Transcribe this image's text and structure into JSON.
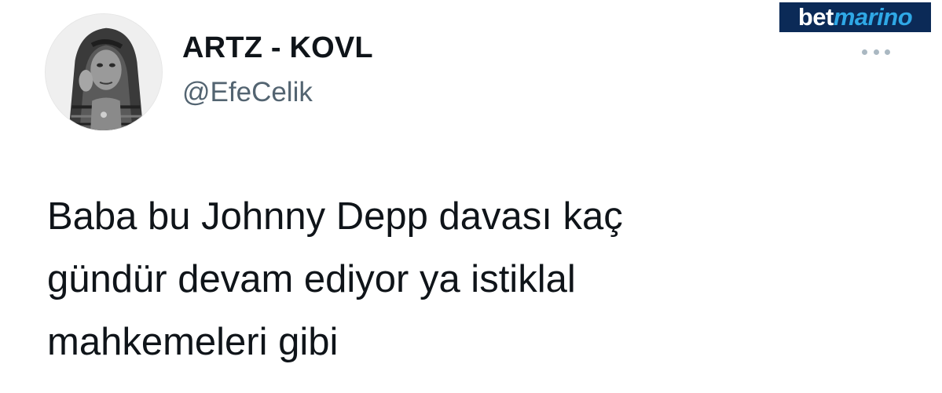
{
  "tweet": {
    "display_name": "ARTZ - KOVL",
    "handle": "@EfeCelik",
    "text_lines": [
      "Baba bu Johnny Depp davası kaç",
      "gündür devam ediyor ya istiklal",
      "mahkemeleri gibi"
    ]
  },
  "watermark": {
    "part_a": "bet",
    "part_b": "marino",
    "bg_color": "#0b2a57",
    "accent_color": "#2fa8e6"
  },
  "icons": {
    "more": "more-horizontal-icon",
    "avatar": "avatar-photo"
  },
  "colors": {
    "text": "#0f1419",
    "secondary": "#536471",
    "background": "#ffffff"
  }
}
